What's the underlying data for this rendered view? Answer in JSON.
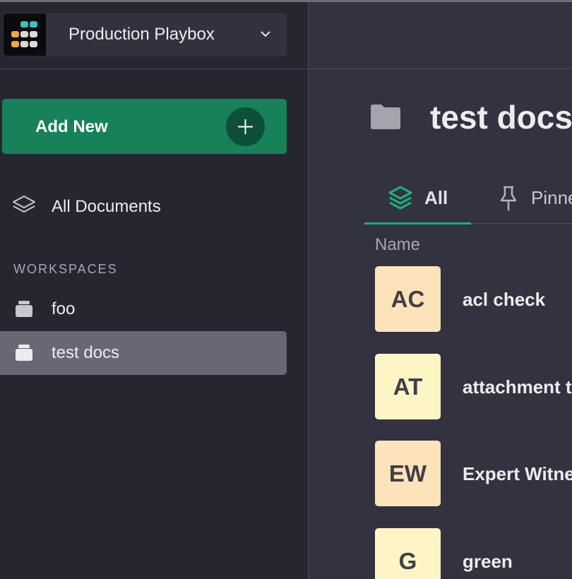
{
  "org": {
    "name": "Production Playbox"
  },
  "sidebar": {
    "add_new": "Add New",
    "all_documents": "All Documents",
    "workspaces_heading": "WORKSPACES",
    "workspaces": [
      {
        "label": "foo",
        "active": false
      },
      {
        "label": "test docs",
        "active": true
      }
    ]
  },
  "main": {
    "title": "test docs",
    "tabs": [
      {
        "label": "All",
        "active": true
      },
      {
        "label": "Pinned",
        "active": false
      }
    ],
    "column_name": "Name",
    "documents": [
      {
        "initials": "AC",
        "name": "acl check",
        "color": "#fde3b9"
      },
      {
        "initials": "AT",
        "name": "attachment test",
        "color": "#fef5c5"
      },
      {
        "initials": "EW",
        "name": "Expert Witness",
        "color": "#fde3b9"
      },
      {
        "initials": "G",
        "name": "green",
        "color": "#fef5c5"
      }
    ]
  },
  "colors": {
    "accent": "#17815a",
    "tab_underline": "#1fb07a",
    "sidebar_bg": "#262631",
    "main_bg": "#323240"
  }
}
